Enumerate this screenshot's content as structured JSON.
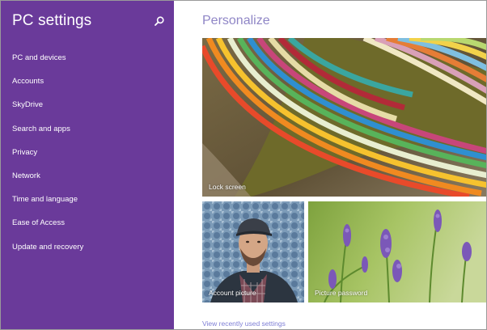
{
  "sidebar": {
    "title": "PC settings",
    "search_icon": "search-icon",
    "items": [
      {
        "label": "PC and devices"
      },
      {
        "label": "Accounts"
      },
      {
        "label": "SkyDrive"
      },
      {
        "label": "Search and apps"
      },
      {
        "label": "Privacy"
      },
      {
        "label": "Network"
      },
      {
        "label": "Time and language"
      },
      {
        "label": "Ease of Access"
      },
      {
        "label": "Update and recovery"
      }
    ]
  },
  "main": {
    "title": "Personalize",
    "tiles": {
      "lock_screen": {
        "label": "Lock screen"
      },
      "account_picture": {
        "label": "Account picture"
      },
      "picture_password": {
        "label": "Picture password"
      }
    },
    "recent_link": "View recently used settings"
  },
  "colors": {
    "sidebar_bg": "#6a3a9a",
    "title_accent": "#8f86c6",
    "link": "#7f7fd6"
  }
}
